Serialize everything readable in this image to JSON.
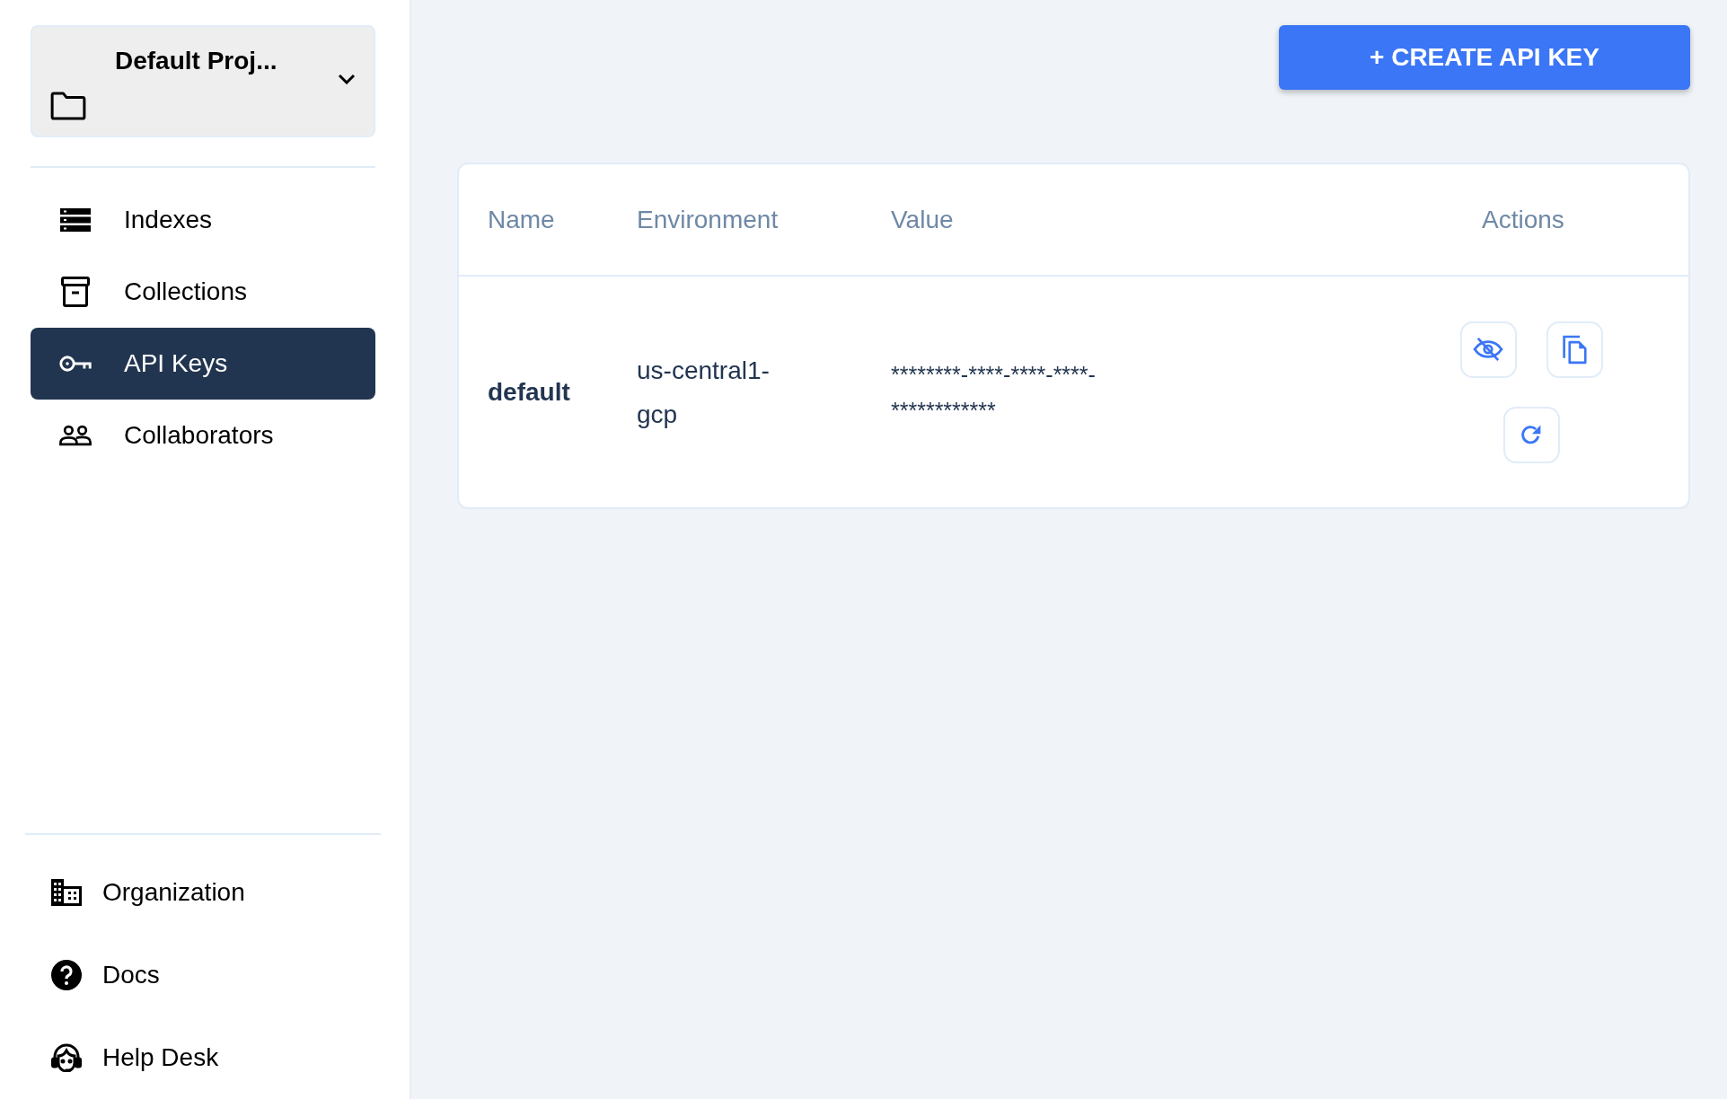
{
  "project": {
    "name": "Default Proj..."
  },
  "nav": [
    {
      "label": "Indexes",
      "selected": false
    },
    {
      "label": "Collections",
      "selected": false
    },
    {
      "label": "API Keys",
      "selected": true
    },
    {
      "label": "Collaborators",
      "selected": false
    }
  ],
  "footer_nav": [
    {
      "label": "Organization"
    },
    {
      "label": "Docs"
    },
    {
      "label": "Help Desk"
    }
  ],
  "create_button": {
    "label": "+ CREATE API KEY"
  },
  "table": {
    "columns": [
      "Name",
      "Environment",
      "Value",
      "Actions"
    ],
    "rows": [
      {
        "name": "default",
        "environment": "us-central1-gcp",
        "value": "********-****-****-****-************"
      }
    ]
  }
}
